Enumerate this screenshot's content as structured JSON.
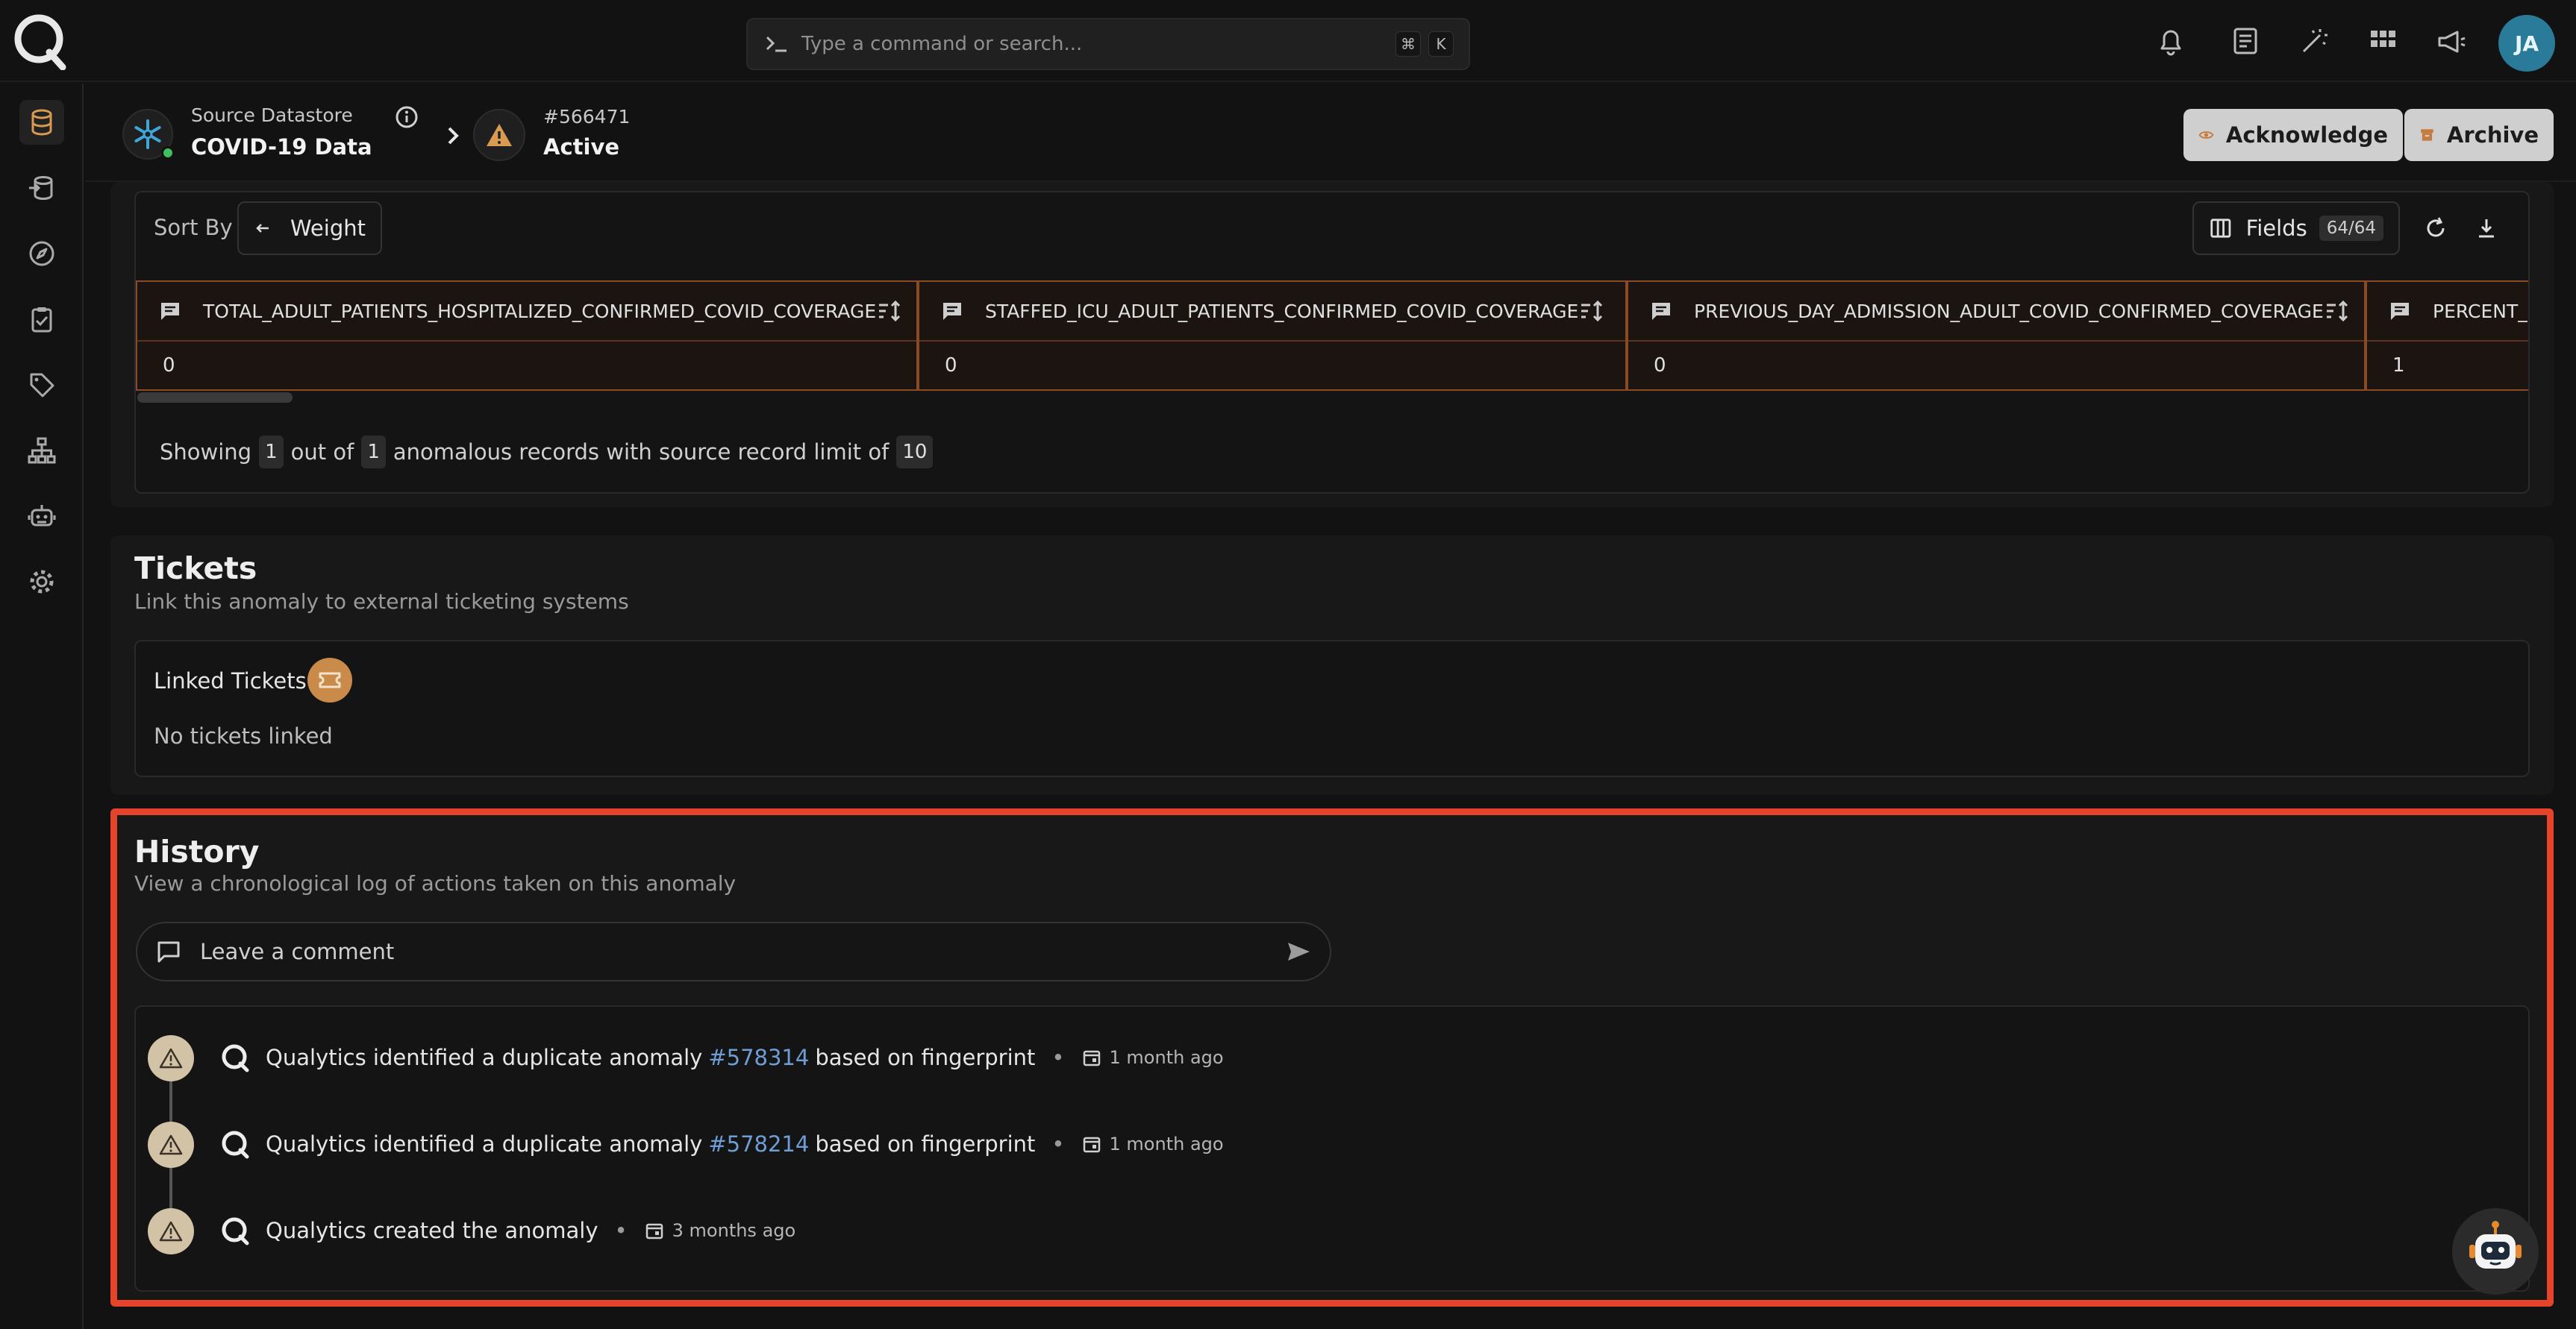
{
  "topbar": {
    "command_placeholder": "Type a command or search...",
    "shortcut_keys": [
      "⌘",
      "K"
    ],
    "avatar_initials": "JA"
  },
  "breadcrumb": {
    "datastore_label": "Source Datastore",
    "datastore_name": "COVID-19 Data",
    "anomaly_id": "#566471",
    "anomaly_status": "Active"
  },
  "actions": {
    "acknowledge_label": "Acknowledge",
    "archive_label": "Archive"
  },
  "records": {
    "sort_label": "Sort By",
    "sort_value": "Weight",
    "fields_label": "Fields",
    "fields_count": "64/64",
    "columns": [
      {
        "name": "TOTAL_ADULT_PATIENTS_HOSPITALIZED_CONFIRMED_COVID_COVERAGE",
        "value": "0"
      },
      {
        "name": "STAFFED_ICU_ADULT_PATIENTS_CONFIRMED_COVID_COVERAGE",
        "value": "0"
      },
      {
        "name": "PREVIOUS_DAY_ADMISSION_ADULT_COVID_CONFIRMED_COVERAGE",
        "value": "0"
      },
      {
        "name": "PERCENT_",
        "value": "1"
      }
    ],
    "showing_prefix": "Showing",
    "showing_count": "1",
    "showing_mid": "out of",
    "showing_total": "1",
    "showing_suffix": "anomalous records with source record limit of",
    "source_limit": "10"
  },
  "tickets": {
    "title": "Tickets",
    "subtitle": "Link this anomaly to external ticketing systems",
    "linked_label": "Linked Tickets",
    "empty_text": "No tickets linked"
  },
  "history": {
    "title": "History",
    "subtitle": "View a chronological log of actions taken on this anomaly",
    "comment_placeholder": "Leave a comment",
    "events": [
      {
        "text": "Qualytics identified a duplicate anomaly",
        "link": "#578314",
        "suffix": "based on fingerprint",
        "time": "1 month ago"
      },
      {
        "text": "Qualytics identified a duplicate anomaly",
        "link": "#578214",
        "suffix": "based on fingerprint",
        "time": "1 month ago"
      },
      {
        "text": "Qualytics created the anomaly",
        "link": "",
        "suffix": "",
        "time": "3 months ago"
      }
    ]
  },
  "colors": {
    "accent": "#c98a4a",
    "highlight": "#e5442b",
    "link": "#6f9ed6",
    "column_border": "#8a4a26"
  }
}
